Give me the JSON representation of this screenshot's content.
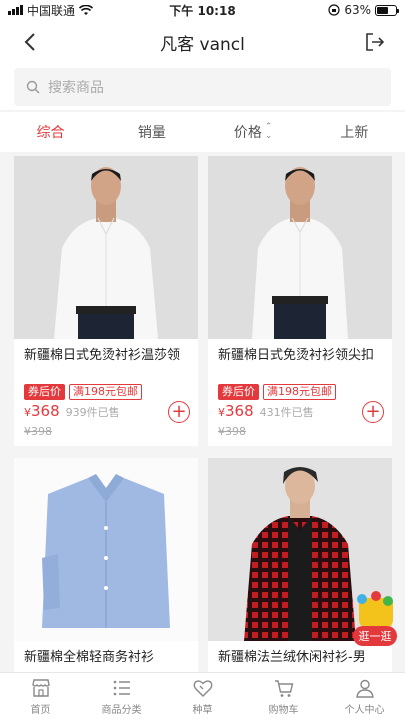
{
  "status": {
    "carrier": "中国联通",
    "time": "下午 10:18",
    "battery": "63%",
    "battery_level": 0.63
  },
  "nav": {
    "title": "凡客 vancl"
  },
  "search": {
    "placeholder": "搜索商品"
  },
  "sort": {
    "items": [
      "综合",
      "销量",
      "价格",
      "上新"
    ],
    "active": "综合"
  },
  "products": [
    {
      "name": "新疆棉日式免烫衬衫温莎领",
      "tag_price": "券后价",
      "tag_promo": "满198元包邮",
      "price_symbol": "¥",
      "price": "368",
      "sold": "939件已售",
      "old_price": "¥398",
      "image": "man-in-white-shirt"
    },
    {
      "name": "新疆棉日式免烫衬衫领尖扣",
      "tag_price": "券后价",
      "tag_promo": "满198元包邮",
      "price_symbol": "¥",
      "price": "368",
      "sold": "431件已售",
      "old_price": "¥398",
      "image": "man-in-white-shirt"
    },
    {
      "name": "新疆棉全棉轻商务衬衫",
      "image": "folded-blue-shirt"
    },
    {
      "name": "新疆棉法兰绒休闲衬衫-男",
      "image": "man-in-red-plaid-shirt"
    }
  ],
  "floating": {
    "label": "逛一逛"
  },
  "tabbar": {
    "items": [
      {
        "label": "首页",
        "icon": "store-icon"
      },
      {
        "label": "商品分类",
        "icon": "list-icon"
      },
      {
        "label": "种草",
        "icon": "heart-icon"
      },
      {
        "label": "购物车",
        "icon": "cart-icon"
      },
      {
        "label": "个人中心",
        "icon": "user-icon"
      }
    ]
  },
  "colors": {
    "accent": "#e4393c",
    "background": "#f4f4f4"
  }
}
